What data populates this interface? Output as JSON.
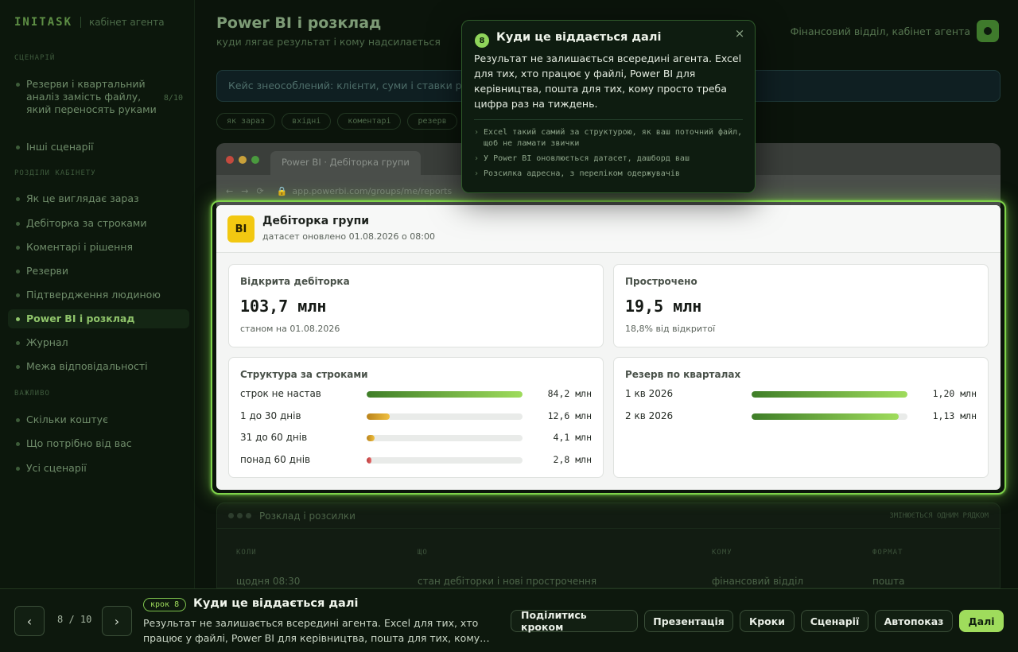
{
  "brand": {
    "logo": "INITASK",
    "subtitle": "кабінет агента"
  },
  "sidebar": {
    "section_scenario": "СЦЕНАРІЙ",
    "scenarios": [
      {
        "label": "Резерви і квартальний аналіз замість файлу, який переносять руками",
        "count": "8/10"
      },
      {
        "label": "Інші сценарії"
      }
    ],
    "section_steps": "РОЗДІЛИ КАБІНЕТУ",
    "steps": [
      {
        "label": "Як це виглядає зараз"
      },
      {
        "label": "Дебіторка за строками"
      },
      {
        "label": "Коментарі і рішення"
      },
      {
        "label": "Резерви"
      },
      {
        "label": "Підтвердження людиною"
      },
      {
        "label": "Power BI і розклад"
      },
      {
        "label": "Журнал"
      },
      {
        "label": "Межа відповідальності"
      }
    ],
    "section_more": "ВАЖЛИВО",
    "more": [
      {
        "label": "Скільки коштує"
      },
      {
        "label": "Що потрібно від вас"
      },
      {
        "label": "Усі сценарії"
      }
    ]
  },
  "main": {
    "title": "Power BI і розклад",
    "subtitle": "куди лягає результат і кому надсилається",
    "user": "Фінансовий відділ, кабінет агента",
    "case_text": "Кейс знеособлений: клієнти, суми і ставки резервів умовні",
    "chips": [
      "як зараз",
      "вхідні",
      "коментарі",
      "резерв"
    ]
  },
  "browser": {
    "tab": "Power BI · Дебіторка групи",
    "url": "app.powerbi.com/groups/me/reports"
  },
  "report": {
    "logo": "BI",
    "title": "Дебіторка групи",
    "subtitle": "датасет оновлено 01.08.2026 о 08:00",
    "kpi_open": {
      "label": "Відкрита дебіторка",
      "value": "103,7 млн",
      "note": "станом на 01.08.2026"
    },
    "kpi_overdue": {
      "label": "Прострочено",
      "value": "19,5 млн",
      "note": "18,8% від відкритої"
    },
    "aging": {
      "title": "Структура за строками",
      "rows": [
        {
          "label": "строк не настав",
          "value": "84,2 млн",
          "share": 1.0,
          "color": "green"
        },
        {
          "label": "1 до 30 днів",
          "value": "12,6 млн",
          "share": 0.15,
          "color": "amber"
        },
        {
          "label": "31 до 60 днів",
          "value": "4,1 млн",
          "share": 0.049,
          "color": "amber"
        },
        {
          "label": "понад 60 днів",
          "value": "2,8 млн",
          "share": 0.033,
          "color": "red"
        }
      ]
    },
    "reserve": {
      "title": "Резерв по кварталах",
      "rows": [
        {
          "label": "1 кв 2026",
          "value": "1,20 млн",
          "share": 1.0,
          "color": "green"
        },
        {
          "label": "2 кв 2026",
          "value": "1,13 млн",
          "share": 0.942,
          "color": "green"
        }
      ]
    }
  },
  "schedule": {
    "title": "Розклад і розсилки",
    "edit": "ЗМІНЮЄТЬСЯ ОДНИМ РЯДКОМ",
    "headers": [
      "КОЛИ",
      "ЩО",
      "КОМУ",
      "ФОРМАТ"
    ],
    "row": [
      "щодня 08:30",
      "стан дебіторки і нові прострочення",
      "фінансовий відділ",
      "пошта"
    ]
  },
  "tooltip": {
    "step_num": "8",
    "title": "Куди це віддається далі",
    "body": "Результат не залишається всередині агента. Excel для тих, хто працює у файлі, Power BI для керівництва, пошта для тих, кому просто треба цифра раз на тиждень.",
    "bullets": [
      "Excel такий самий за структурою, як ваш поточний файл, щоб не ламати звички",
      "У Power BI оновлюється датасет, дашборд ваш",
      "Розсилка адресна, з переліком одержувачів"
    ],
    "close": "×"
  },
  "bottom": {
    "prev": "‹",
    "next": "›",
    "counter": "8 / 10",
    "chip": "крок 8",
    "title": "Куди це віддається далі",
    "desc": "Результат не залишається всередині агента. Excel для тих, хто працює у файлі, Power BI для керівництва, пошта для тих, кому…",
    "buttons": {
      "share": "Поділитись кроком",
      "present": "Презентація",
      "steps": "Кроки",
      "scenarios": "Сценарії",
      "autoplay": "Автопоказ",
      "next": "Далі"
    }
  },
  "colors": {
    "accent": "#9fdc5c",
    "ring": "#7fd34a",
    "bi_yellow": "#f2c811",
    "overdue_red": "#c94a4a",
    "amber": "#e0a530"
  }
}
